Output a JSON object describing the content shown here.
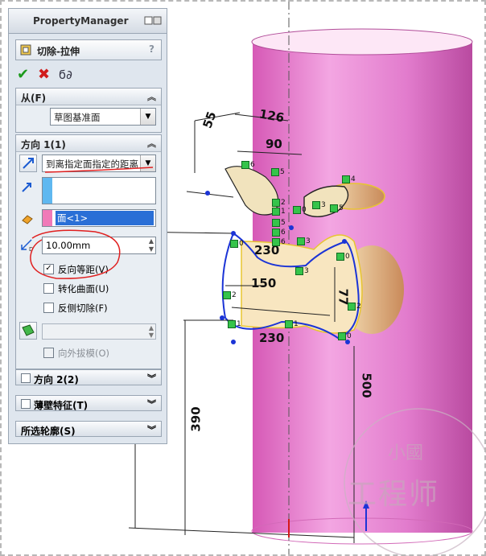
{
  "panel": {
    "title": "PropertyManager",
    "feature_title": "切除-拉伸",
    "help": "?",
    "ok_icon": "check-icon",
    "cancel_icon": "x-icon",
    "preview_icon": "glasses-icon"
  },
  "from": {
    "header": "从(F)",
    "value": "草图基准面"
  },
  "direction1": {
    "header": "方向 1(1)",
    "end_condition": "到离指定面指定的距离",
    "face_selection": "面<1>",
    "offset_value": "10.00mm",
    "reverse_offset": "反向等距(V)",
    "translate_surface": "转化曲面(U)",
    "flip_side": "反侧切除(F)",
    "draft_outward": "向外拔模(O)"
  },
  "direction2": {
    "header": "方向 2(2)"
  },
  "thin_feature": {
    "header": "薄壁特征(T)"
  },
  "selected_contours": {
    "header": "所选轮廓(S)"
  },
  "dimensions": [
    "55",
    "126",
    "90",
    "230",
    "150",
    "77",
    "230",
    "500",
    "390"
  ],
  "sketch_labels": [
    "6",
    "5",
    "4",
    "2",
    "1",
    "0",
    "3",
    "6",
    "5",
    "0",
    "3",
    "5",
    "3",
    "6",
    "0",
    "1",
    "2",
    "0",
    "2",
    "1"
  ],
  "watermark": "工程师",
  "watermark_top": "小國"
}
